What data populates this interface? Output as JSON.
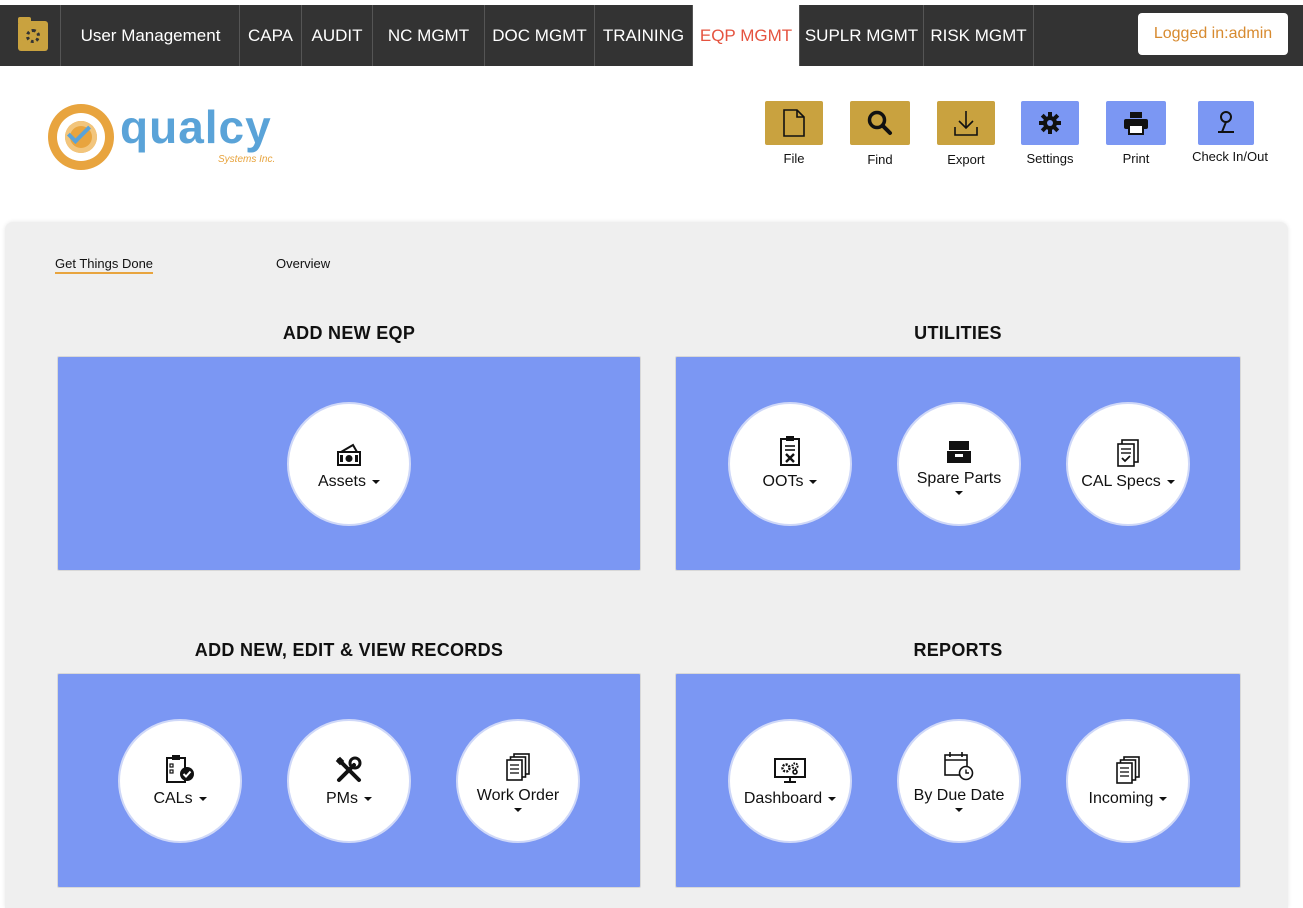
{
  "nav": {
    "items": [
      {
        "label": "User Management"
      },
      {
        "label": "CAPA"
      },
      {
        "label": "AUDIT"
      },
      {
        "label": "NC MGMT"
      },
      {
        "label": "DOC MGMT"
      },
      {
        "label": "TRAINING"
      },
      {
        "label": "EQP MGMT",
        "active": true
      },
      {
        "label": "SUPLR MGMT"
      },
      {
        "label": "RISK MGMT"
      }
    ],
    "login_label": "Logged in:admin"
  },
  "logo": {
    "word": "qualcy",
    "sub": "Systems Inc."
  },
  "toolbar": {
    "file": "File",
    "find": "Find",
    "export": "Export",
    "settings": "Settings",
    "print": "Print",
    "checkinout": "Check In/Out"
  },
  "tabs": {
    "get_things_done": "Get Things Done",
    "overview": "Overview"
  },
  "sections": {
    "add_new_eqp": {
      "title": "ADD NEW EQP",
      "assets": "Assets"
    },
    "utilities": {
      "title": "UTILITIES",
      "oots": "OOTs",
      "spare_parts": "Spare Parts",
      "cal_specs": "CAL Specs"
    },
    "records": {
      "title": "ADD NEW, EDIT & VIEW RECORDS",
      "cals": "CALs",
      "pms": "PMs",
      "work_order": "Work Order"
    },
    "reports": {
      "title": "REPORTS",
      "dashboard": "Dashboard",
      "by_due_date": "By Due Date",
      "incoming": "Incoming"
    }
  },
  "colors": {
    "nav_bg": "#333333",
    "active_tab": "#e5533f",
    "gold": "#c9a23f",
    "blue": "#7b97f3",
    "accent": "#e8a43e"
  }
}
